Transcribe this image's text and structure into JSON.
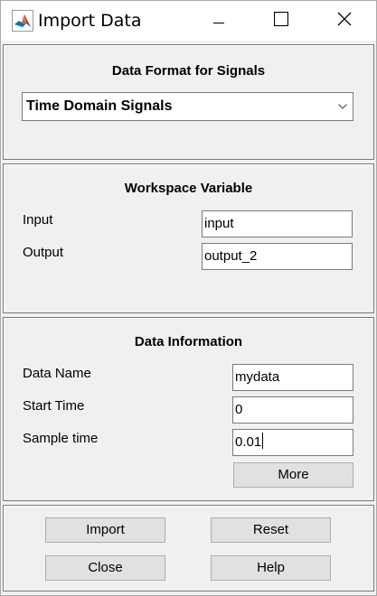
{
  "window": {
    "title": "Import Data",
    "icons": {
      "app": "matlab-logo-icon",
      "minimize": "minimize-icon",
      "maximize": "maximize-icon",
      "close": "close-icon"
    }
  },
  "format_panel": {
    "title": "Data Format for Signals",
    "selected": "Time Domain Signals",
    "arrow_icon": "chevron-down-icon"
  },
  "workspace_panel": {
    "title": "Workspace Variable",
    "input_label": "Input",
    "input_value": "input",
    "output_label": "Output",
    "output_value": "output_2"
  },
  "info_panel": {
    "title": "Data Information",
    "name_label": "Data Name",
    "name_value": "mydata",
    "start_label": "Start Time",
    "start_value": "0",
    "sample_label": "Sample time",
    "sample_value": "0.01",
    "more_label": "More"
  },
  "actions": {
    "import_label": "Import",
    "reset_label": "Reset",
    "close_label": "Close",
    "help_label": "Help"
  },
  "colors": {
    "panel_bg": "#f0f0f0",
    "button_bg": "#e1e1e1",
    "border": "#7a7a7a"
  }
}
